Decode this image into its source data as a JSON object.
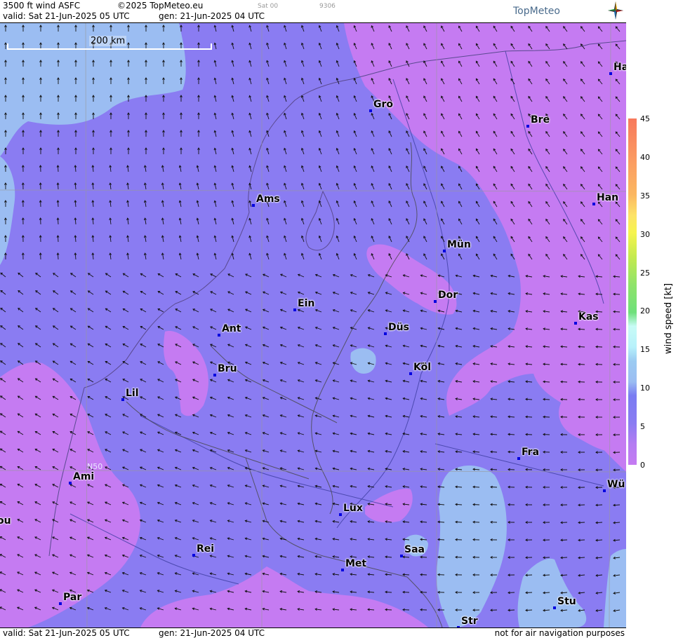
{
  "header": {
    "product": "3500 ft wind ASFC",
    "copyright": "©2025 TopMeteo.eu",
    "small_1": "Sat 00",
    "small_2": "9306",
    "valid": "valid:  Sat  21-Jun-2025  05 UTC",
    "gen": "gen:  21-Jun-2025 04 UTC",
    "logo": "TopMeteo"
  },
  "footer": {
    "valid": "valid:  Sat  21-Jun-2025  05 UTC",
    "gen": "gen:  21-Jun-2025 04 UTC",
    "disclaimer": "not for air navigation purposes"
  },
  "map": {
    "scale_label": "200 km",
    "lat_label": "N50",
    "cities": [
      {
        "name": "Gro"
      },
      {
        "name": "Bre"
      },
      {
        "name": "Ha"
      },
      {
        "name": "Ams"
      },
      {
        "name": "Han"
      },
      {
        "name": "Mün"
      },
      {
        "name": "Dor"
      },
      {
        "name": "Ein"
      },
      {
        "name": "Kas"
      },
      {
        "name": "Ant"
      },
      {
        "name": "Düs"
      },
      {
        "name": "Bru"
      },
      {
        "name": "Köl"
      },
      {
        "name": "Lil"
      },
      {
        "name": "Fra"
      },
      {
        "name": "Ami"
      },
      {
        "name": "Wü"
      },
      {
        "name": "ou"
      },
      {
        "name": "Lux"
      },
      {
        "name": "Rei"
      },
      {
        "name": "Saa"
      },
      {
        "name": "Met"
      },
      {
        "name": "Par"
      },
      {
        "name": "Stu"
      },
      {
        "name": "Str"
      }
    ]
  },
  "legend": {
    "title": "wind  speed  [kt]",
    "ticks": [
      "45",
      "40",
      "35",
      "30",
      "25",
      "20",
      "15",
      "10",
      "5",
      "0"
    ]
  },
  "colors": {
    "band_0_5": "#c57bf2",
    "band_5_10": "#8a7cf2",
    "band_10_15": "#9bbdf2"
  }
}
